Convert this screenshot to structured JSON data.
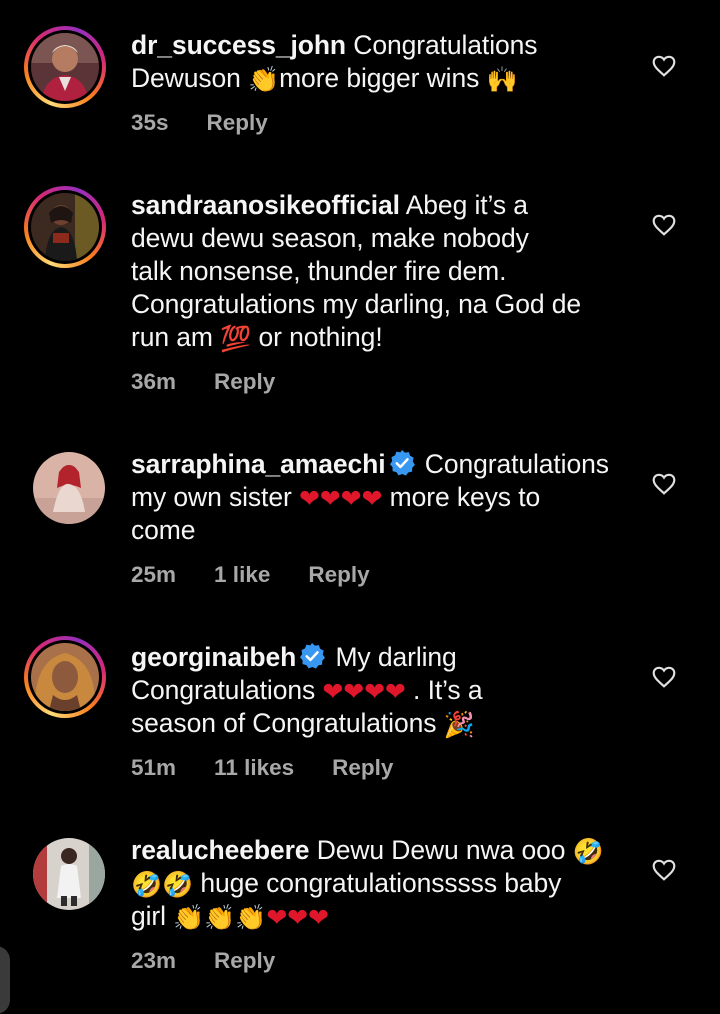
{
  "colors": {
    "background": "#000000",
    "text": "#f5f5f5",
    "meta": "#a8a8a8",
    "verified": "#3897f0",
    "heart": "#e0162b"
  },
  "comments": [
    {
      "username": "dr_success_john",
      "verified": false,
      "story_ring": true,
      "line1": "Congratulations",
      "line2a": "Dewuson",
      "emoji_clap": "👏",
      "line2b": "more bigger wins",
      "emoji_hands": "🙌",
      "time": "35s",
      "reply": "Reply"
    },
    {
      "username": "sandraanosikeofficial",
      "verified": false,
      "story_ring": true,
      "line1": "Abeg it’s a",
      "line2": "dewu dewu season, make nobody",
      "line3": "talk nonsense, thunder fire dem.",
      "line4": "Congratulations my darling, na God de",
      "line5a": "run am",
      "emoji_100": "💯",
      "line5b": "or nothing!",
      "time": "36m",
      "reply": "Reply"
    },
    {
      "username": "sarraphina_amaechi",
      "verified": true,
      "story_ring": false,
      "line1": "Congratulations",
      "line2a": "my own sister",
      "hearts": "❤❤❤❤",
      "line2b": "more keys to",
      "line3": "come",
      "time": "25m",
      "likes": "1 like",
      "reply": "Reply"
    },
    {
      "username": "georginaibeh",
      "verified": true,
      "story_ring": true,
      "line1": "My darling",
      "line2a": "Congratulations",
      "hearts": "❤❤❤❤",
      "line2b": ". It’s a",
      "line3": "season of Congratulations",
      "emoji_party": "🎉",
      "time": "51m",
      "likes": "11 likes",
      "reply": "Reply"
    },
    {
      "username": "realucheebere",
      "verified": false,
      "story_ring": false,
      "line1": "Dewu Dewu nwa ooo",
      "emoji_rofl": "🤣",
      "line2": "huge congratulationsssss baby",
      "line3": "girl",
      "claps": "👏👏👏",
      "hearts": "❤❤❤",
      "time": "23m",
      "reply": "Reply"
    }
  ]
}
